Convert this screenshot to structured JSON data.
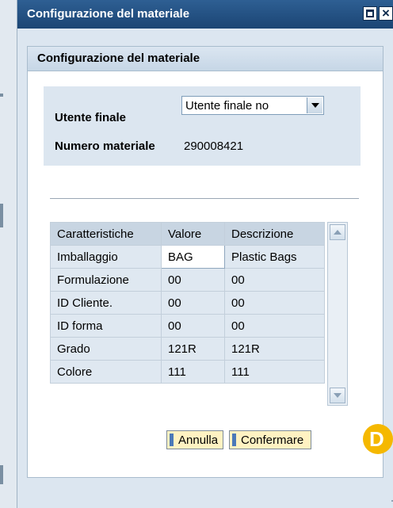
{
  "dialog": {
    "title": "Configurazione del materiale",
    "panel_title": "Configurazione del materiale"
  },
  "form": {
    "end_user_label": "Utente finale",
    "end_user_value": "Utente finale no",
    "material_label": "Numero materiale",
    "material_value": "290008421"
  },
  "table": {
    "headers": [
      "Caratteristiche",
      "Valore",
      "Descrizione"
    ],
    "rows": [
      [
        "Imballaggio",
        "BAG",
        "Plastic Bags"
      ],
      [
        "Formulazione",
        "00",
        "00"
      ],
      [
        "ID Cliente.",
        "00",
        "00"
      ],
      [
        "ID forma",
        "00",
        "00"
      ],
      [
        "Grado",
        "121R",
        "121R"
      ],
      [
        "Colore",
        "111",
        "111"
      ]
    ]
  },
  "buttons": {
    "cancel": "Annulla",
    "confirm": "Confermare"
  },
  "callout": {
    "letter": "D"
  },
  "colors": {
    "titlebar": "#1b4574",
    "button_bg": "#fff2c2",
    "callout": "#f5b800"
  }
}
